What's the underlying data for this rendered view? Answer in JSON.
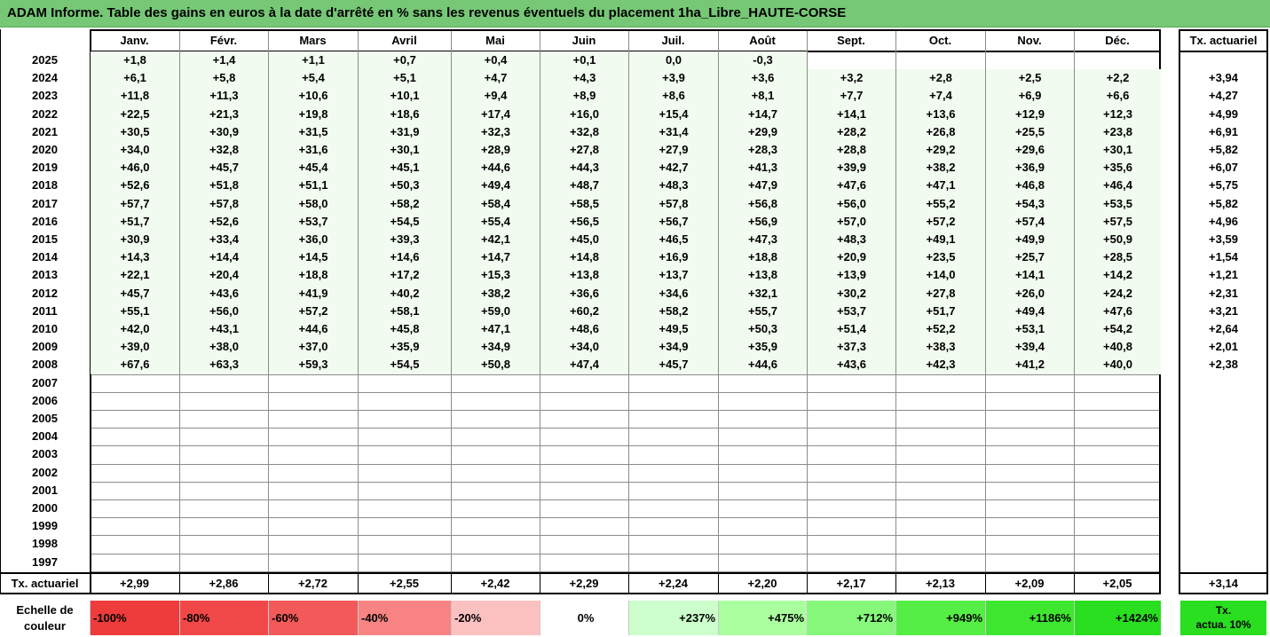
{
  "title": "ADAM Informe. Table des gains en euros à la date d'arrêté en % sans les revenus éventuels du placement 1ha_Libre_HAUTE-CORSE",
  "months": [
    "Janv.",
    "Févr.",
    "Mars",
    "Avril",
    "Mai",
    "Juin",
    "Juil.",
    "Août",
    "Sept.",
    "Oct.",
    "Nov.",
    "Déc."
  ],
  "tx_header": "Tx. actuariel",
  "rows": [
    {
      "year": "2025",
      "values": [
        "+1,8",
        "+1,4",
        "+1,1",
        "+0,7",
        "+0,4",
        "+0,1",
        "0,0",
        "-0,3",
        "",
        "",
        "",
        ""
      ],
      "tx": ""
    },
    {
      "year": "2024",
      "values": [
        "+6,1",
        "+5,8",
        "+5,4",
        "+5,1",
        "+4,7",
        "+4,3",
        "+3,9",
        "+3,6",
        "+3,2",
        "+2,8",
        "+2,5",
        "+2,2"
      ],
      "tx": "+3,94"
    },
    {
      "year": "2023",
      "values": [
        "+11,8",
        "+11,3",
        "+10,6",
        "+10,1",
        "+9,4",
        "+8,9",
        "+8,6",
        "+8,1",
        "+7,7",
        "+7,4",
        "+6,9",
        "+6,6"
      ],
      "tx": "+4,27"
    },
    {
      "year": "2022",
      "values": [
        "+22,5",
        "+21,3",
        "+19,8",
        "+18,6",
        "+17,4",
        "+16,0",
        "+15,4",
        "+14,7",
        "+14,1",
        "+13,6",
        "+12,9",
        "+12,3"
      ],
      "tx": "+4,99"
    },
    {
      "year": "2021",
      "values": [
        "+30,5",
        "+30,9",
        "+31,5",
        "+31,9",
        "+32,3",
        "+32,8",
        "+31,4",
        "+29,9",
        "+28,2",
        "+26,8",
        "+25,5",
        "+23,8"
      ],
      "tx": "+6,91"
    },
    {
      "year": "2020",
      "values": [
        "+34,0",
        "+32,8",
        "+31,6",
        "+30,1",
        "+28,9",
        "+27,8",
        "+27,9",
        "+28,3",
        "+28,8",
        "+29,2",
        "+29,6",
        "+30,1"
      ],
      "tx": "+5,82"
    },
    {
      "year": "2019",
      "values": [
        "+46,0",
        "+45,7",
        "+45,4",
        "+45,1",
        "+44,6",
        "+44,3",
        "+42,7",
        "+41,3",
        "+39,9",
        "+38,2",
        "+36,9",
        "+35,6"
      ],
      "tx": "+6,07"
    },
    {
      "year": "2018",
      "values": [
        "+52,6",
        "+51,8",
        "+51,1",
        "+50,3",
        "+49,4",
        "+48,7",
        "+48,3",
        "+47,9",
        "+47,6",
        "+47,1",
        "+46,8",
        "+46,4"
      ],
      "tx": "+5,75"
    },
    {
      "year": "2017",
      "values": [
        "+57,7",
        "+57,8",
        "+58,0",
        "+58,2",
        "+58,4",
        "+58,5",
        "+57,8",
        "+56,8",
        "+56,0",
        "+55,2",
        "+54,3",
        "+53,5"
      ],
      "tx": "+5,82"
    },
    {
      "year": "2016",
      "values": [
        "+51,7",
        "+52,6",
        "+53,7",
        "+54,5",
        "+55,4",
        "+56,5",
        "+56,7",
        "+56,9",
        "+57,0",
        "+57,2",
        "+57,4",
        "+57,5"
      ],
      "tx": "+4,96"
    },
    {
      "year": "2015",
      "values": [
        "+30,9",
        "+33,4",
        "+36,0",
        "+39,3",
        "+42,1",
        "+45,0",
        "+46,5",
        "+47,3",
        "+48,3",
        "+49,1",
        "+49,9",
        "+50,9"
      ],
      "tx": "+3,59"
    },
    {
      "year": "2014",
      "values": [
        "+14,3",
        "+14,4",
        "+14,5",
        "+14,6",
        "+14,7",
        "+14,8",
        "+16,9",
        "+18,8",
        "+20,9",
        "+23,5",
        "+25,7",
        "+28,5"
      ],
      "tx": "+1,54"
    },
    {
      "year": "2013",
      "values": [
        "+22,1",
        "+20,4",
        "+18,8",
        "+17,2",
        "+15,3",
        "+13,8",
        "+13,7",
        "+13,8",
        "+13,9",
        "+14,0",
        "+14,1",
        "+14,2"
      ],
      "tx": "+1,21"
    },
    {
      "year": "2012",
      "values": [
        "+45,7",
        "+43,6",
        "+41,9",
        "+40,2",
        "+38,2",
        "+36,6",
        "+34,6",
        "+32,1",
        "+30,2",
        "+27,8",
        "+26,0",
        "+24,2"
      ],
      "tx": "+2,31"
    },
    {
      "year": "2011",
      "values": [
        "+55,1",
        "+56,0",
        "+57,2",
        "+58,1",
        "+59,0",
        "+60,2",
        "+58,2",
        "+55,7",
        "+53,7",
        "+51,7",
        "+49,4",
        "+47,6"
      ],
      "tx": "+3,21"
    },
    {
      "year": "2010",
      "values": [
        "+42,0",
        "+43,1",
        "+44,6",
        "+45,8",
        "+47,1",
        "+48,6",
        "+49,5",
        "+50,3",
        "+51,4",
        "+52,2",
        "+53,1",
        "+54,2"
      ],
      "tx": "+2,64"
    },
    {
      "year": "2009",
      "values": [
        "+39,0",
        "+38,0",
        "+37,0",
        "+35,9",
        "+34,9",
        "+34,0",
        "+34,9",
        "+35,9",
        "+37,3",
        "+38,3",
        "+39,4",
        "+40,8"
      ],
      "tx": "+2,01"
    },
    {
      "year": "2008",
      "values": [
        "+67,6",
        "+63,3",
        "+59,3",
        "+54,5",
        "+50,8",
        "+47,4",
        "+45,7",
        "+44,6",
        "+43,6",
        "+42,3",
        "+41,2",
        "+40,0"
      ],
      "tx": "+2,38"
    },
    {
      "year": "2007",
      "values": [
        "",
        "",
        "",
        "",
        "",
        "",
        "",
        "",
        "",
        "",
        "",
        ""
      ],
      "tx": ""
    },
    {
      "year": "2006",
      "values": [
        "",
        "",
        "",
        "",
        "",
        "",
        "",
        "",
        "",
        "",
        "",
        ""
      ],
      "tx": ""
    },
    {
      "year": "2005",
      "values": [
        "",
        "",
        "",
        "",
        "",
        "",
        "",
        "",
        "",
        "",
        "",
        ""
      ],
      "tx": ""
    },
    {
      "year": "2004",
      "values": [
        "",
        "",
        "",
        "",
        "",
        "",
        "",
        "",
        "",
        "",
        "",
        ""
      ],
      "tx": ""
    },
    {
      "year": "2003",
      "values": [
        "",
        "",
        "",
        "",
        "",
        "",
        "",
        "",
        "",
        "",
        "",
        ""
      ],
      "tx": ""
    },
    {
      "year": "2002",
      "values": [
        "",
        "",
        "",
        "",
        "",
        "",
        "",
        "",
        "",
        "",
        "",
        ""
      ],
      "tx": ""
    },
    {
      "year": "2001",
      "values": [
        "",
        "",
        "",
        "",
        "",
        "",
        "",
        "",
        "",
        "",
        "",
        ""
      ],
      "tx": ""
    },
    {
      "year": "2000",
      "values": [
        "",
        "",
        "",
        "",
        "",
        "",
        "",
        "",
        "",
        "",
        "",
        ""
      ],
      "tx": ""
    },
    {
      "year": "1999",
      "values": [
        "",
        "",
        "",
        "",
        "",
        "",
        "",
        "",
        "",
        "",
        "",
        ""
      ],
      "tx": ""
    },
    {
      "year": "1998",
      "values": [
        "",
        "",
        "",
        "",
        "",
        "",
        "",
        "",
        "",
        "",
        "",
        ""
      ],
      "tx": ""
    },
    {
      "year": "1997",
      "values": [
        "",
        "",
        "",
        "",
        "",
        "",
        "",
        "",
        "",
        "",
        "",
        ""
      ],
      "tx": ""
    }
  ],
  "footer": {
    "label": "Tx. actuariel",
    "values": [
      "+2,99",
      "+2,86",
      "+2,72",
      "+2,55",
      "+2,42",
      "+2,29",
      "+2,24",
      "+2,20",
      "+2,17",
      "+2,13",
      "+2,09",
      "+2,05"
    ],
    "tx": "+3,14"
  },
  "scale": {
    "label": "Echelle de couleur",
    "label_line1": "Echelle de",
    "label_line2": "couleur",
    "items": [
      {
        "text": "-100%",
        "color": "#ee3b3b"
      },
      {
        "text": "-80%",
        "color": "#f04848"
      },
      {
        "text": "-60%",
        "color": "#f25a5a"
      },
      {
        "text": "-40%",
        "color": "#f78383"
      },
      {
        "text": "-20%",
        "color": "#fbc0c0"
      },
      {
        "text": "0%",
        "color": "#ffffff"
      },
      {
        "text": "+237%",
        "color": "#ccffcc"
      },
      {
        "text": "+475%",
        "color": "#aaff9f"
      },
      {
        "text": "+712%",
        "color": "#85f87a"
      },
      {
        "text": "+949%",
        "color": "#55ee44"
      },
      {
        "text": "+1186%",
        "color": "#3ee630"
      },
      {
        "text": "+1424%",
        "color": "#2ade20"
      }
    ],
    "tx_label_line1": "Tx.",
    "tx_label_line2": "actua. 10%",
    "tx_color": "#2ade20"
  },
  "colors": {
    "title_bg": "#76c776",
    "filled_cell_bg": "#f1fbef"
  }
}
